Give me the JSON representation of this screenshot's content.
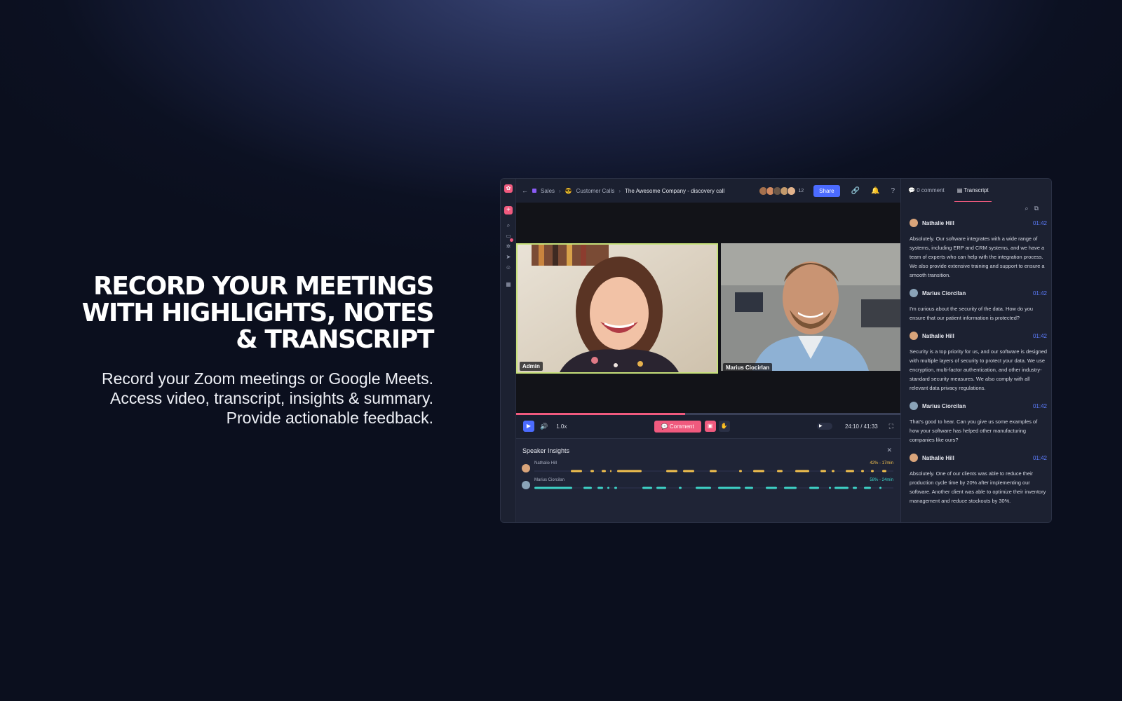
{
  "hero": {
    "title_line1": "RECORD YOUR MEETINGS",
    "title_line2": "WITH HIGHLIGHTS, NOTES",
    "title_line3": "& TRANSCRIPT",
    "desc_line1": "Record your Zoom meetings or Google Meets.",
    "desc_line2": "Access video, transcript, insights & summary.",
    "desc_line3": "Provide actionable feedback."
  },
  "breadcrumb": {
    "items": [
      "Sales",
      "Customer Calls",
      "The Awesome Company - discovery call"
    ]
  },
  "header": {
    "participants_count": "12",
    "share_label": "Share"
  },
  "video": {
    "tile_left_name": "Admin",
    "tile_right_name": "Marius Ciocirlan",
    "progress": 0.44
  },
  "controls": {
    "speed": "1.0x",
    "comment_label": "Comment",
    "time": "24:10 / 41:33"
  },
  "insights": {
    "title": "Speaker Insights",
    "speakers": [
      {
        "name": "Nathalie Hill",
        "stat": "42% - 17min",
        "color": "#f2c14e"
      },
      {
        "name": "Marius Ciorcilan",
        "stat": "58% - 24min",
        "color": "#3ed3c7"
      }
    ]
  },
  "sidebar": {
    "tab_comments": "0 comment",
    "tab_transcript": "Transcript",
    "entries": [
      {
        "speaker": "Nathalie Hill",
        "time": "01:42",
        "text": "Absolutely. Our software integrates with a wide range of systems, including ERP and CRM systems, and we have a team of experts who can help with the integration process. We also provide extensive training and support to ensure a smooth transition."
      },
      {
        "speaker": "Marius Ciorcilan",
        "time": "01:42",
        "text": "I'm curious about the security of the data. How do you ensure that our patient information is protected?"
      },
      {
        "speaker": "Nathalie Hill",
        "time": "01:42",
        "text": "Security is a top priority for us, and our software is designed with multiple layers of security to protect your data. We use encryption, multi-factor authentication, and other industry-standard security measures. We also comply with all relevant data privacy regulations."
      },
      {
        "speaker": "Marius Ciorcilan",
        "time": "01:42",
        "text": "That's good to hear. Can you give us some examples of how your software has helped other manufacturing companies like ours?"
      },
      {
        "speaker": "Nathalie Hill",
        "time": "01:42",
        "text": "Absolutely. One of our clients was able to reduce their production cycle time by 20% after implementing our software. Another client was able to optimize their inventory management and reduce stockouts by 30%."
      }
    ]
  },
  "colors": {
    "accent": "#f05a7e",
    "primary": "#4b6bff",
    "timestamp": "#5d7dff"
  }
}
